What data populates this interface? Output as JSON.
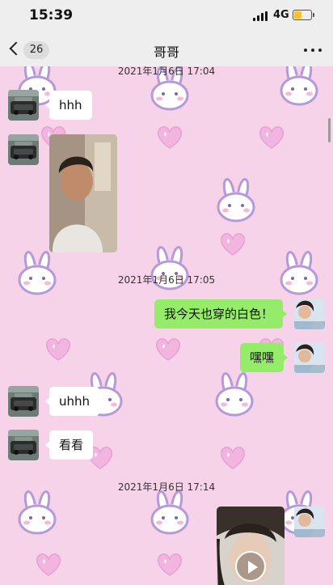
{
  "status_bar": {
    "time": "15:39",
    "network": "4G",
    "battery_level": 0.45
  },
  "nav": {
    "back_count": "26",
    "title": "哥哥",
    "more_icon": "more-dots-icon"
  },
  "colors": {
    "chat_background": "#f7d3ea",
    "outgoing_bubble": "#95ec69",
    "incoming_bubble": "#ffffff",
    "nav_background": "#eeeeee"
  },
  "messages": {
    "timestamp_1": "2021年1月6日 17:04",
    "incoming_1": "hhh",
    "incoming_2_type": "image",
    "timestamp_2": "2021年1月6日 17:05",
    "outgoing_1": "我今天也穿的白色！",
    "outgoing_2": "嘿嘿",
    "incoming_3": "uhhh",
    "incoming_4": "看看",
    "timestamp_3": "2021年1月6日 17:14",
    "outgoing_3_type": "video"
  }
}
